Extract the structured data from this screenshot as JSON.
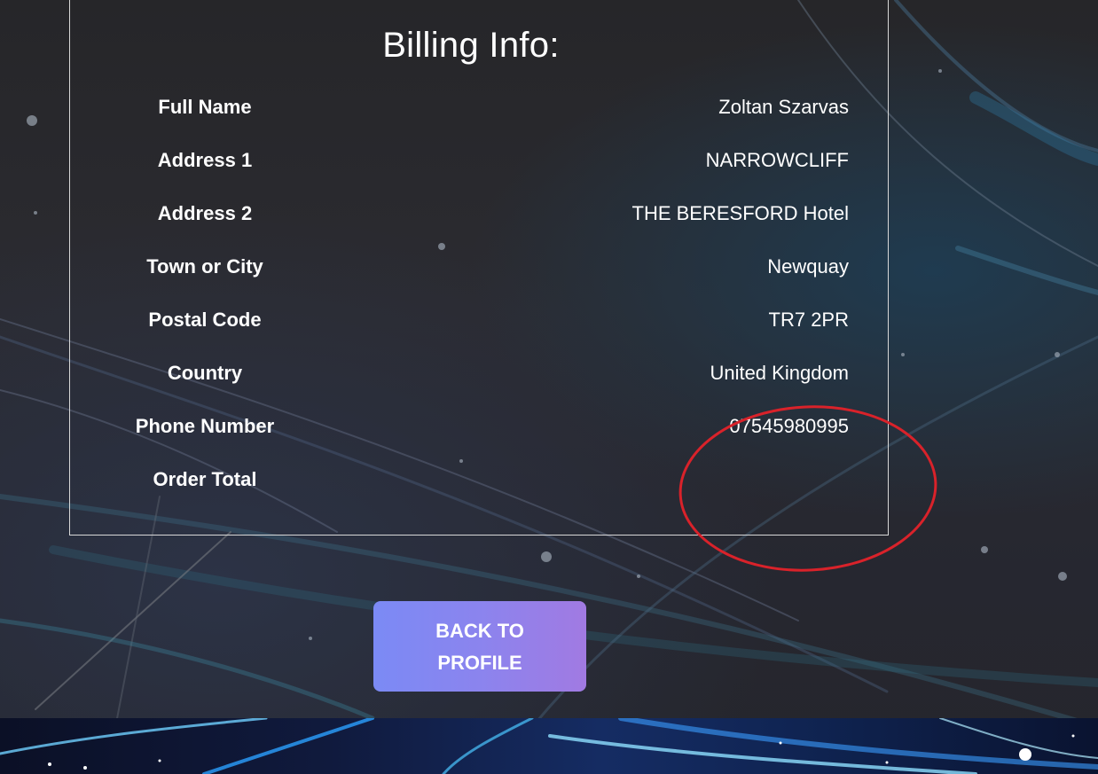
{
  "billing": {
    "title": "Billing Info:",
    "rows": [
      {
        "label": "Full Name",
        "value": "Zoltan Szarvas"
      },
      {
        "label": "Address 1",
        "value": "NARROWCLIFF"
      },
      {
        "label": "Address 2",
        "value": "THE BERESFORD Hotel"
      },
      {
        "label": "Town or City",
        "value": "Newquay"
      },
      {
        "label": "Postal Code",
        "value": "TR7 2PR"
      },
      {
        "label": "Country",
        "value": "United Kingdom"
      },
      {
        "label": "Phone Number",
        "value": "07545980995"
      },
      {
        "label": "Order Total",
        "value": ""
      }
    ]
  },
  "actions": {
    "back_to_profile_label": "BACK TO PROFILE"
  },
  "colors": {
    "annotation": "#d9222a",
    "button_start": "#7b8af5",
    "button_end": "#a17ae2",
    "box_border": "#d8d8d8"
  },
  "icons": {
    "annotation": "red-circle-annotation"
  }
}
